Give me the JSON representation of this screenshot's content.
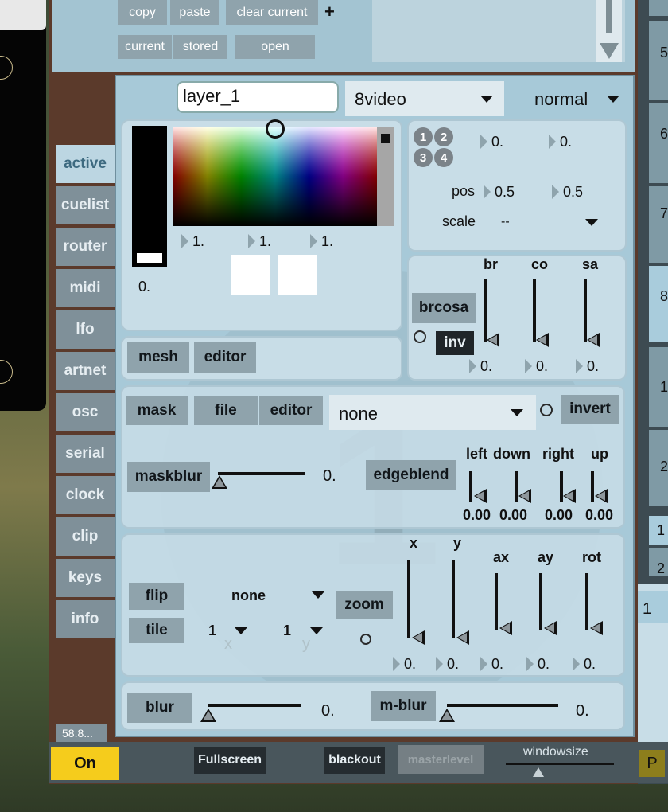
{
  "top": {
    "copy": "copy",
    "paste": "paste",
    "clear_current": "clear current",
    "plus": "+",
    "current": "current",
    "stored": "stored",
    "open": "open"
  },
  "right_strip": {
    "items": [
      "5",
      "6",
      "7",
      "8",
      "1",
      "2",
      "1",
      "2"
    ],
    "bottom_value": "1"
  },
  "header": {
    "layer_name": "layer_1",
    "source": "8video",
    "blend_mode": "normal"
  },
  "tabs": [
    "active",
    "cuelist",
    "router",
    "midi",
    "lfo",
    "artnet",
    "osc",
    "serial",
    "clock",
    "clip",
    "keys",
    "info"
  ],
  "color": {
    "alpha_value": "0.",
    "rgb": [
      "1.",
      "1.",
      "1."
    ]
  },
  "position": {
    "quad_buttons": [
      "1",
      "2",
      "3",
      "4"
    ],
    "val_a": "0.",
    "val_b": "0.",
    "pos_label": "pos",
    "pos_x": "0.5",
    "pos_y": "0.5",
    "scale_label": "scale",
    "scale_value": "--"
  },
  "mesh": {
    "mesh": "mesh",
    "editor": "editor"
  },
  "brcosa": {
    "button": "brcosa",
    "inv": "inv",
    "sliders": [
      {
        "label": "br",
        "value": "0."
      },
      {
        "label": "co",
        "value": "0."
      },
      {
        "label": "sa",
        "value": "0."
      }
    ]
  },
  "mask": {
    "mask": "mask",
    "file": "file",
    "editor": "editor",
    "file_value": "none",
    "invert": "invert"
  },
  "maskblur": {
    "label": "maskblur",
    "value": "0."
  },
  "edgeblend": {
    "button": "edgeblend",
    "sliders": [
      {
        "label": "left",
        "value": "0.00"
      },
      {
        "label": "down",
        "value": "0.00"
      },
      {
        "label": "right",
        "value": "0.00"
      },
      {
        "label": "up",
        "value": "0.00"
      }
    ]
  },
  "transform": {
    "flip": "flip",
    "flip_value": "none",
    "tile": "tile",
    "tile_x": "1",
    "tile_y": "1",
    "x_label": "x",
    "y_label": "y",
    "zoom": "zoom",
    "sliders": [
      {
        "label": "x",
        "value": "0."
      },
      {
        "label": "y",
        "value": "0."
      },
      {
        "label": "ax",
        "value": "0."
      },
      {
        "label": "ay",
        "value": "0."
      },
      {
        "label": "rot",
        "value": "0."
      }
    ]
  },
  "blur": {
    "blur": "blur",
    "blur_value": "0.",
    "mblur": "m-blur",
    "mblur_value": "0."
  },
  "watermark": "1",
  "bottom": {
    "fps": "58.8...",
    "on": "On",
    "fullscreen": "Fullscreen",
    "blackout": "blackout",
    "masterlevel": "masterlevel",
    "windowsize": "windowsize",
    "p": "P"
  },
  "colors": {
    "panel": "#c8dde7",
    "button": "#8fa3ac",
    "on": "#f5cc1c",
    "dark": "#1f2529"
  }
}
